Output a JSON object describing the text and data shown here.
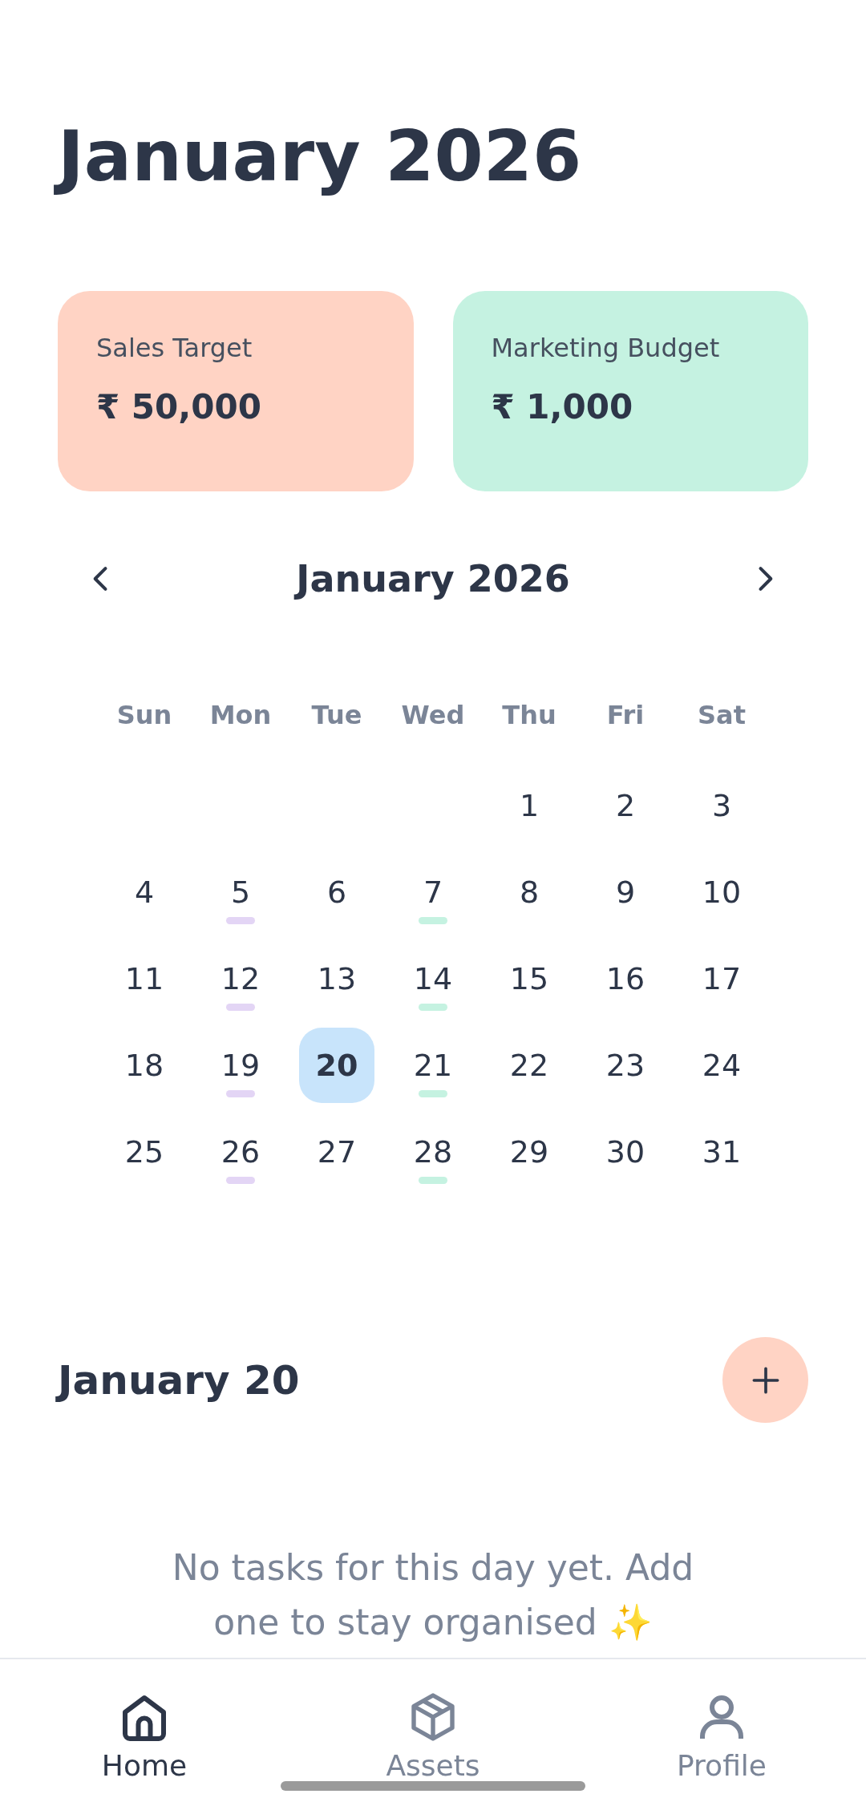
{
  "title": "January 2026",
  "cards": [
    {
      "label": "Sales Target",
      "value": "₹ 50,000",
      "kind": "sales"
    },
    {
      "label": "Marketing Budget",
      "value": "₹ 1,000",
      "kind": "marketing"
    }
  ],
  "calendar": {
    "title": "January 2026",
    "weekdays": [
      "Sun",
      "Mon",
      "Tue",
      "Wed",
      "Thu",
      "Fri",
      "Sat"
    ],
    "weeks": [
      [
        {
          "label": "1",
          "selected": false
        },
        {
          "label": "2",
          "selected": false
        },
        {
          "label": "3",
          "selected": false
        }
      ],
      [
        {
          "label": "4",
          "selected": false
        },
        {
          "label": "5",
          "selected": false,
          "color": "#e3d5f5"
        },
        {
          "label": "6",
          "selected": false
        },
        {
          "label": "7",
          "selected": false,
          "color": "#c5f2e1"
        },
        {
          "label": "8",
          "selected": false
        },
        {
          "label": "9",
          "selected": false
        },
        {
          "label": "10",
          "selected": false
        }
      ],
      [
        {
          "label": "11",
          "selected": false
        },
        {
          "label": "12",
          "selected": false,
          "color": "#e3d5f5"
        },
        {
          "label": "13",
          "selected": false
        },
        {
          "label": "14",
          "selected": false,
          "color": "#c5f2e1"
        },
        {
          "label": "15",
          "selected": false
        },
        {
          "label": "16",
          "selected": false
        },
        {
          "label": "17",
          "selected": false
        }
      ],
      [
        {
          "label": "18",
          "selected": false
        },
        {
          "label": "19",
          "selected": false,
          "color": "#e3d5f5"
        },
        {
          "label": "20",
          "selected": true
        },
        {
          "label": "21",
          "selected": false,
          "color": "#c5f2e1"
        },
        {
          "label": "22",
          "selected": false
        },
        {
          "label": "23",
          "selected": false
        },
        {
          "label": "24",
          "selected": false
        }
      ],
      [
        {
          "label": "25",
          "selected": false
        },
        {
          "label": "26",
          "selected": false,
          "color": "#e3d5f5"
        },
        {
          "label": "27",
          "selected": false
        },
        {
          "label": "28",
          "selected": false,
          "color": "#c5f2e1"
        },
        {
          "label": "29",
          "selected": false
        },
        {
          "label": "30",
          "selected": false
        },
        {
          "label": "31",
          "selected": false
        }
      ]
    ]
  },
  "day": {
    "heading": "January 20",
    "empty_message": "No tasks for this day yet. Add one to stay organised ✨"
  },
  "nav": [
    {
      "label": "Home",
      "selected": true,
      "kind": "home"
    },
    {
      "label": "Assets",
      "selected": false,
      "kind": "assets"
    },
    {
      "label": "Profile",
      "selected": false,
      "kind": "profile"
    }
  ]
}
